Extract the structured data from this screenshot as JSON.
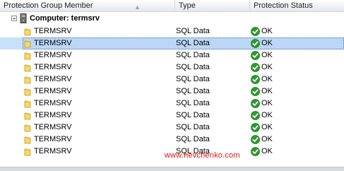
{
  "header": {
    "col_member": "Protection Group Member",
    "col_type": "Type",
    "col_status": "Protection Status"
  },
  "group": {
    "label": "Computer: termsrv",
    "expander_icon": "collapse-minus-icon",
    "icon": "computer-icon"
  },
  "rows": [
    {
      "name": "TERMSRV",
      "type": "SQL Data",
      "status": "OK",
      "selected": false
    },
    {
      "name": "TERMSRV",
      "type": "SQL Data",
      "status": "OK",
      "selected": true
    },
    {
      "name": "TERMSRV",
      "type": "SQL Data",
      "status": "OK",
      "selected": false
    },
    {
      "name": "TERMSRV",
      "type": "SQL Data",
      "status": "OK",
      "selected": false
    },
    {
      "name": "TERMSRV",
      "type": "SQL Data",
      "status": "OK",
      "selected": false
    },
    {
      "name": "TERMSRV",
      "type": "SQL Data",
      "status": "OK",
      "selected": false
    },
    {
      "name": "TERMSRV",
      "type": "SQL Data",
      "status": "OK",
      "selected": false
    },
    {
      "name": "TERMSRV",
      "type": "SQL Data",
      "status": "OK",
      "selected": false
    },
    {
      "name": "TERMSRV",
      "type": "SQL Data",
      "status": "OK",
      "selected": false
    },
    {
      "name": "TERMSRV",
      "type": "SQL Data",
      "status": "OK",
      "selected": false
    },
    {
      "name": "TERMSRV",
      "type": "SQL Data",
      "status": "OK",
      "selected": false
    }
  ],
  "watermark": "www.hevchenko.com",
  "colors": {
    "selection": "#c8e0f9",
    "ok_green": "#2e9a2e",
    "folder_yellow": "#f2c94c",
    "watermark_red": "#e01010"
  }
}
